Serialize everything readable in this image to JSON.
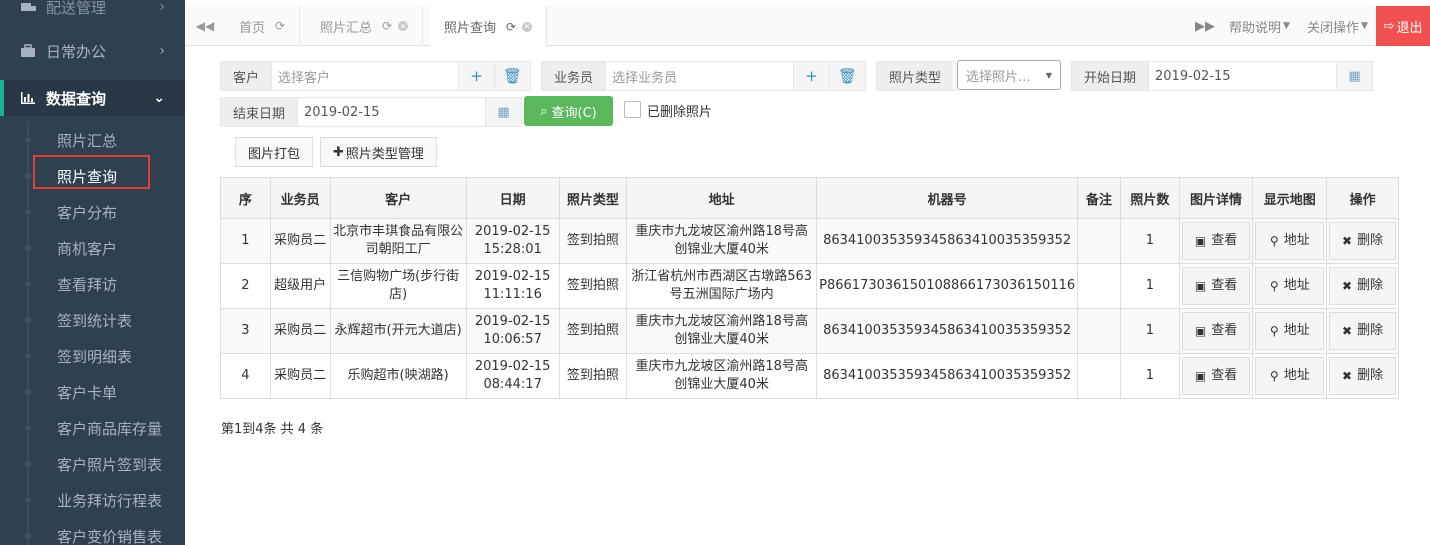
{
  "sidebar": {
    "top_cut": "配送管理",
    "menus": [
      {
        "label": "日常办公",
        "icon": "briefcase-icon",
        "arrow": "›"
      },
      {
        "label": "数据查询",
        "icon": "bar-chart-icon",
        "arrow": "⌄"
      }
    ],
    "items": [
      "照片汇总",
      "照片查询",
      "客户分布",
      "商机客户",
      "查看拜访",
      "签到统计表",
      "签到明细表",
      "客户卡单",
      "客户商品库存量",
      "客户照片签到表",
      "业务拜访行程表",
      "客户变价销售表"
    ]
  },
  "tabs": {
    "items": [
      {
        "label": "首页"
      },
      {
        "label": "照片汇总"
      },
      {
        "label": "照片查询"
      }
    ],
    "help_label": "帮助说明",
    "close_label": "关闭操作",
    "logout_label": "退出"
  },
  "filters": {
    "customer_label": "客户",
    "customer_placeholder": "选择客户",
    "salesman_label": "业务员",
    "salesman_placeholder": "选择业务员",
    "photo_type_label": "照片类型",
    "photo_type_placeholder": "选择照片...",
    "start_label": "开始日期",
    "start_value": "2019-02-15",
    "end_label": "结束日期",
    "end_value": "2019-02-15",
    "query_label": "查询(C)",
    "deleted_label": "已删除照片"
  },
  "toolbar": {
    "pack_label": "图片打包",
    "type_manage_label": "照片类型管理"
  },
  "table": {
    "columns": [
      "序",
      "业务员",
      "客户",
      "日期",
      "照片类型",
      "地址",
      "机器号",
      "备注",
      "照片数",
      "图片详情",
      "显示地图",
      "操作"
    ],
    "view_label": "查看",
    "map_label": "地址",
    "delete_label": "删除",
    "rows": [
      {
        "no": "1",
        "salesman": "采购员二",
        "customer": "北京市丰琪食品有限公司朝阳工厂",
        "date": "2019-02-15 15:28:01",
        "type": "签到拍照",
        "address": "重庆市九龙坡区渝州路18号高创锦业大厦40米",
        "machine": "863410035359345863410035359352",
        "note": "",
        "count": "1"
      },
      {
        "no": "2",
        "salesman": "超级用户",
        "customer": "三信购物广场(步行街店)",
        "date": "2019-02-15 11:11:16",
        "type": "签到拍照",
        "address": "浙江省杭州市西湖区古墩路563号五洲国际广场内",
        "machine": "P866173036150108866173036150116",
        "note": "",
        "count": "1"
      },
      {
        "no": "3",
        "salesman": "采购员二",
        "customer": "永辉超市(开元大道店)",
        "date": "2019-02-15 10:06:57",
        "type": "签到拍照",
        "address": "重庆市九龙坡区渝州路18号高创锦业大厦40米",
        "machine": "863410035359345863410035359352",
        "note": "",
        "count": "1"
      },
      {
        "no": "4",
        "salesman": "采购员二",
        "customer": "乐购超市(映湖路)",
        "date": "2019-02-15 08:44:17",
        "type": "签到拍照",
        "address": "重庆市九龙坡区渝州路18号高创锦业大厦40米",
        "machine": "863410035359345863410035359352",
        "note": "",
        "count": "1"
      }
    ]
  },
  "footer": {
    "summary": "第1到4条 共 4 条"
  },
  "colors": {
    "sidebar_bg": "#2f4050",
    "accent_green": "#5cb85c",
    "logout_red": "#f05050",
    "link_blue": "#3c8dbc"
  }
}
